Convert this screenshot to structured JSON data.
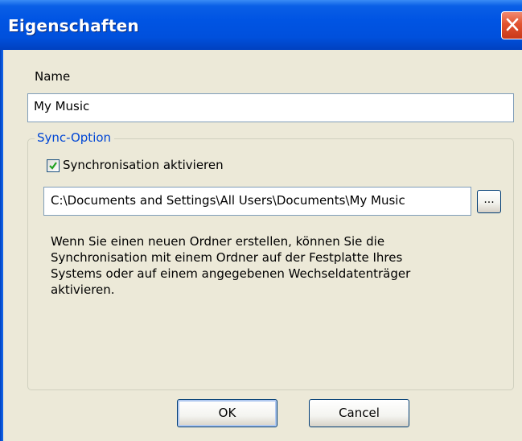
{
  "window": {
    "title": "Eigenschaften",
    "close_icon": "close-icon"
  },
  "name_field": {
    "label": "Name",
    "value": "My Music"
  },
  "sync_group": {
    "title": "Sync-Option",
    "checkbox_label": "Synchronisation aktivieren",
    "checkbox_checked": true,
    "path_value": "C:\\Documents and Settings\\All Users\\Documents\\My Music",
    "browse_label": "...",
    "description": "Wenn Sie einen neuen Ordner erstellen, können Sie die\nSynchronisation mit einem Ordner auf der Festplatte Ihres\nSystems oder auf einem angegebenen Wechseldatenträger\naktivieren."
  },
  "buttons": {
    "ok": "OK",
    "cancel": "Cancel"
  },
  "colors": {
    "titlebar": "#0054e3",
    "background": "#ece9d8",
    "group_title": "#0046d5",
    "close_button": "#e2532f"
  }
}
